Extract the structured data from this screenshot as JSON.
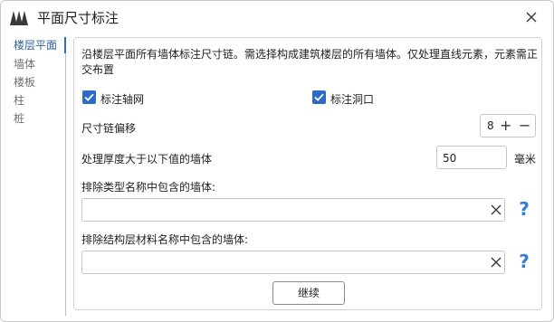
{
  "window": {
    "title": "平面尺寸标注",
    "icons": {
      "logo": "app-logo-icon",
      "close": "close-icon"
    }
  },
  "sidebar": {
    "items": [
      {
        "label": "楼层平面",
        "active": true
      },
      {
        "label": "墙体",
        "active": false
      },
      {
        "label": "楼板",
        "active": false
      },
      {
        "label": "柱",
        "active": false
      },
      {
        "label": "桩",
        "active": false
      }
    ]
  },
  "main": {
    "description": "沿楼层平面所有墙体标注尺寸链。需选择构成建筑楼层的所有墙体。仅处理直线元素，元素需正交布置",
    "checkbox_axis": {
      "label": "标注轴网",
      "checked": true
    },
    "checkbox_openings": {
      "label": "标注洞口",
      "checked": true
    },
    "offset": {
      "label": "尺寸链偏移",
      "value": "8",
      "plus": "+",
      "minus": "−"
    },
    "thickness": {
      "label": "处理厚度大于以下值的墙体",
      "value": "50",
      "unit": "毫米"
    },
    "exclude_type": {
      "label": "排除类型名称中包含的墙体:",
      "value": "",
      "help": "?"
    },
    "exclude_material": {
      "label": "排除结构层材料名称中包含的墙体:",
      "value": "",
      "help": "?"
    },
    "continue_label": "继续"
  },
  "colors": {
    "accent": "#2d6bc8",
    "help": "#2f7fd8",
    "sidebar_active": "#2f5f9c"
  }
}
